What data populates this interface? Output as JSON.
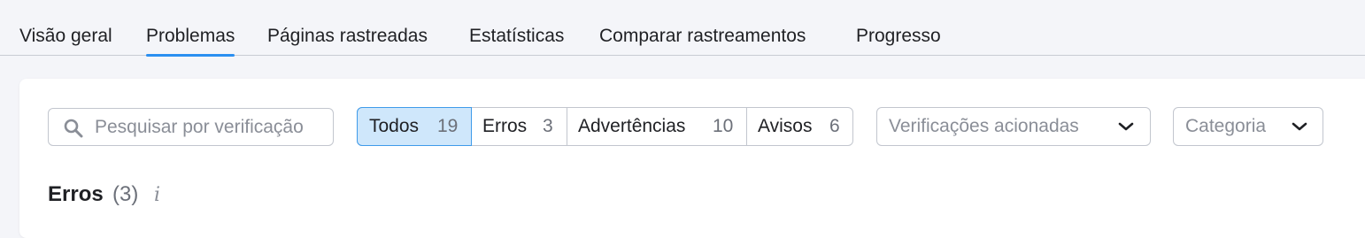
{
  "tabs": [
    {
      "label": "Visão geral"
    },
    {
      "label": "Problemas",
      "active": true
    },
    {
      "label": "Páginas rastreadas"
    },
    {
      "label": "Estatísticas"
    },
    {
      "label": "Comparar rastreamentos"
    },
    {
      "label": "Progresso"
    }
  ],
  "search": {
    "placeholder": "Pesquisar por verificação",
    "icon": "search-icon"
  },
  "filters": {
    "todos": {
      "label": "Todos",
      "count": "19",
      "selected": true
    },
    "erros": {
      "label": "Erros",
      "count": "3"
    },
    "advertencias": {
      "label": "Advertências",
      "count": "10"
    },
    "avisos": {
      "label": "Avisos",
      "count": "6"
    }
  },
  "dropdowns": {
    "verificacoes": {
      "label": "Verificações acionadas"
    },
    "categoria": {
      "label": "Categoria"
    }
  },
  "section": {
    "title": "Erros",
    "count": "(3)",
    "info_icon": "i"
  },
  "colors": {
    "accent": "#2b8ff0",
    "selected_bg": "#cfe7fb",
    "page_bg": "#f4f5f9"
  }
}
